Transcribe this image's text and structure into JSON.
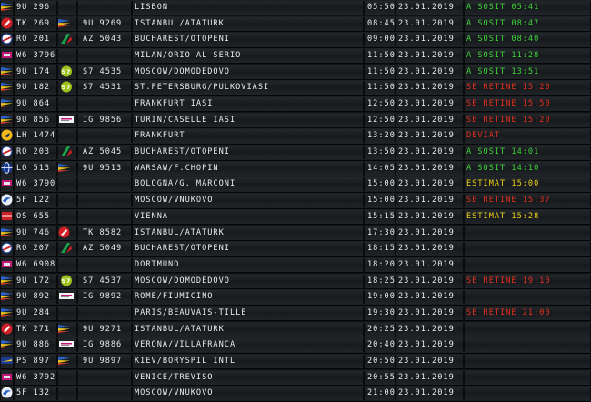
{
  "board": {
    "status_colors": {
      "landed": "#3fd43a",
      "delayed": "#e6301f",
      "diverted": "#e6301f",
      "estimated": "#f0d21a"
    },
    "rows": [
      {
        "logo1": "blue-tri-icon",
        "code1": "9U 296",
        "logo2": "",
        "code2": "",
        "dest": "LISBON",
        "time": "05:50",
        "date": "23.01.2019",
        "status": "A SOSIT 05:41",
        "kind": "landed"
      },
      {
        "logo1": "red-tail-icon",
        "code1": "TK 269",
        "logo2": "blue-tri-icon",
        "code2": "9U 9269",
        "dest": "ISTANBUL/ATATURK",
        "time": "08:45",
        "date": "23.01.2019",
        "status": "A SOSIT 08:47",
        "kind": "landed"
      },
      {
        "logo1": "red-ring-icon",
        "code1": "RO 201",
        "logo2": "green-wing-icon",
        "code2": "AZ 5043",
        "dest": "BUCHAREST/OTOPENI",
        "time": "09:00",
        "date": "23.01.2019",
        "status": "A SOSIT 08:40",
        "kind": "landed"
      },
      {
        "logo1": "pink-box-icon",
        "code1": "W6 3796",
        "logo2": "",
        "code2": "",
        "dest": "MILAN/ORIO AL SERIO",
        "time": "11:50",
        "date": "23.01.2019",
        "status": "A SOSIT 11:28",
        "kind": "landed"
      },
      {
        "logo1": "blue-tri-icon",
        "code1": "9U 174",
        "logo2": "green-circle-icon",
        "code2": "S7 4535",
        "dest": "MOSCOW/DOMODEDOVO",
        "time": "11:50",
        "date": "23.01.2019",
        "status": "A SOSIT 13:51",
        "kind": "landed"
      },
      {
        "logo1": "blue-tri-icon",
        "code1": "9U 182",
        "logo2": "green-circle-icon",
        "code2": "S7 4531",
        "dest": "ST.PETERSBURG/PULKOVIASI",
        "time": "11:50",
        "date": "23.01.2019",
        "status": "SE RETINE 15:20",
        "kind": "delayed"
      },
      {
        "logo1": "blue-tri-icon",
        "code1": "9U 864",
        "logo2": "",
        "code2": "",
        "dest": "FRANKFURT            IASI",
        "time": "12:50",
        "date": "23.01.2019",
        "status": "SE RETINE 15:50",
        "kind": "delayed"
      },
      {
        "logo1": "blue-tri-icon",
        "code1": "9U 856",
        "logo2": "white-box-icon",
        "code2": "IG 9856",
        "dest": "TURIN/CASELLE        IASI",
        "time": "12:50",
        "date": "23.01.2019",
        "status": "SE RETINE 15:20",
        "kind": "delayed"
      },
      {
        "logo1": "yellow-crane-icon",
        "code1": "LH 1474",
        "logo2": "",
        "code2": "",
        "dest": "FRANKFURT",
        "time": "13:20",
        "date": "23.01.2019",
        "status": "DEVIAT",
        "kind": "diverted"
      },
      {
        "logo1": "red-ring-icon",
        "code1": "RO 203",
        "logo2": "green-wing-icon",
        "code2": "AZ 5045",
        "dest": "BUCHAREST/OTOPENI",
        "time": "13:50",
        "date": "23.01.2019",
        "status": "A SOSIT 14:01",
        "kind": "landed"
      },
      {
        "logo1": "blue-globe-icon",
        "code1": "LO 513",
        "logo2": "blue-tri-icon",
        "code2": "9U 9513",
        "dest": "WARSAW/F.CHOPIN",
        "time": "14:05",
        "date": "23.01.2019",
        "status": "A SOSIT 14:10",
        "kind": "landed"
      },
      {
        "logo1": "pink-box-icon",
        "code1": "W6 3790",
        "logo2": "",
        "code2": "",
        "dest": "BOLOGNA/G. MARCONI",
        "time": "15:00",
        "date": "23.01.2019",
        "status": "ESTIMAT 15:00",
        "kind": "estimated"
      },
      {
        "logo1": "blue-swirl-icon",
        "code1": "5F 122",
        "logo2": "",
        "code2": "",
        "dest": "MOSCOW/VNUKOVO",
        "time": "15:00",
        "date": "23.01.2019",
        "status": "SE RETINE 15:37",
        "kind": "delayed"
      },
      {
        "logo1": "red-flag-icon",
        "code1": "OS 655",
        "logo2": "",
        "code2": "",
        "dest": "VIENNA",
        "time": "15:15",
        "date": "23.01.2019",
        "status": "ESTIMAT 15:28",
        "kind": "estimated"
      },
      {
        "logo1": "blue-tri-icon",
        "code1": "9U 746",
        "logo2": "red-tail-icon",
        "code2": "TK 8582",
        "dest": "ISTANBUL/ATATURK",
        "time": "17:30",
        "date": "23.01.2019",
        "status": "",
        "kind": ""
      },
      {
        "logo1": "red-ring-icon",
        "code1": "RO 207",
        "logo2": "green-wing-icon",
        "code2": "AZ 5049",
        "dest": "BUCHAREST/OTOPENI",
        "time": "18:15",
        "date": "23.01.2019",
        "status": "",
        "kind": ""
      },
      {
        "logo1": "pink-box-icon",
        "code1": "W6 6908",
        "logo2": "",
        "code2": "",
        "dest": "DORTMUND",
        "time": "18:20",
        "date": "23.01.2019",
        "status": "",
        "kind": ""
      },
      {
        "logo1": "blue-tri-icon",
        "code1": "9U 172",
        "logo2": "green-circle-icon",
        "code2": "S7 4537",
        "dest": "MOSCOW/DOMODEDOVO",
        "time": "18:25",
        "date": "23.01.2019",
        "status": "SE RETINE 19:10",
        "kind": "delayed"
      },
      {
        "logo1": "blue-tri-icon",
        "code1": "9U 892",
        "logo2": "white-box-icon",
        "code2": "IG 9892",
        "dest": "ROME/FIUMICINO",
        "time": "19:00",
        "date": "23.01.2019",
        "status": "",
        "kind": ""
      },
      {
        "logo1": "blue-tri-icon",
        "code1": "9U 284",
        "logo2": "",
        "code2": "",
        "dest": "PARIS/BEAUVAIS-TILLE",
        "time": "19:30",
        "date": "23.01.2019",
        "status": "SE RETINE 21:00",
        "kind": "delayed"
      },
      {
        "logo1": "red-tail-icon",
        "code1": "TK 271",
        "logo2": "blue-tri-icon",
        "code2": "9U 9271",
        "dest": "ISTANBUL/ATATURK",
        "time": "20:25",
        "date": "23.01.2019",
        "status": "",
        "kind": ""
      },
      {
        "logo1": "blue-tri-icon",
        "code1": "9U 886",
        "logo2": "white-box-icon",
        "code2": "IG 9886",
        "dest": "VERONA/VILLAFRANCA",
        "time": "20:40",
        "date": "23.01.2019",
        "status": "",
        "kind": ""
      },
      {
        "logo1": "yellow-wing-icon",
        "code1": "PS 897",
        "logo2": "blue-tri-icon",
        "code2": "9U 9897",
        "dest": "KIEV/BORYSPIL INTL",
        "time": "20:50",
        "date": "23.01.2019",
        "status": "",
        "kind": ""
      },
      {
        "logo1": "pink-box-icon",
        "code1": "W6 3792",
        "logo2": "",
        "code2": "",
        "dest": "VENICE/TREVISO",
        "time": "20:55",
        "date": "23.01.2019",
        "status": "",
        "kind": ""
      },
      {
        "logo1": "blue-swirl-icon",
        "code1": "5F 132",
        "logo2": "",
        "code2": "",
        "dest": "MOSCOW/VNUKOVO",
        "time": "21:00",
        "date": "23.01.2019",
        "status": "",
        "kind": ""
      }
    ]
  }
}
